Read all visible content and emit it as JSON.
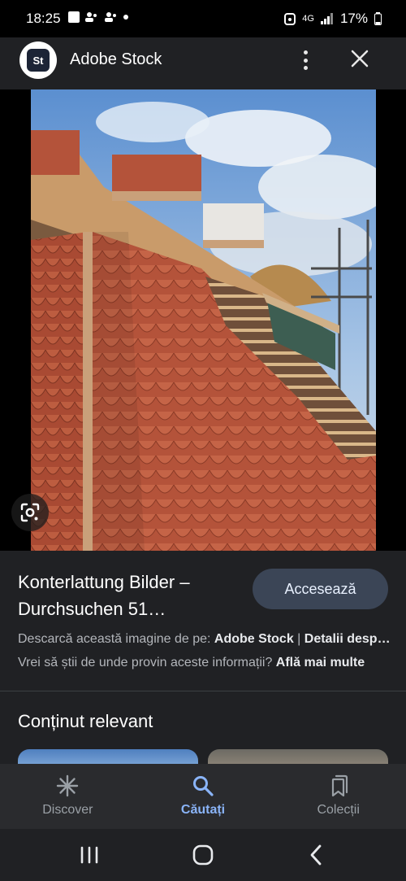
{
  "status_bar": {
    "time": "18:25",
    "network": "4G",
    "battery": "17%"
  },
  "header": {
    "logo_text": "St",
    "title": "Adobe Stock",
    "menu_icon": "more-vert-icon",
    "close_icon": "close-icon"
  },
  "image": {
    "lens_icon": "google-lens-icon"
  },
  "result": {
    "title": "Konterlattung Bilder – Durchsuchen 51…",
    "visit_label": "Accesează",
    "source_prefix": "Descarcă această imagine de pe: ",
    "source_name": "Adobe Stock",
    "source_separator": " | ",
    "source_details": "Detalii desp…",
    "info_question": "Vrei să știi de unde provin aceste informații? ",
    "info_link": "Află mai multe"
  },
  "related": {
    "section_title": "Conținut relevant"
  },
  "bottom_nav": {
    "items": [
      {
        "label": "Discover",
        "icon": "asterisk-icon",
        "active": false
      },
      {
        "label": "Căutați",
        "icon": "search-icon",
        "active": true
      },
      {
        "label": "Colecții",
        "icon": "bookmarks-icon",
        "active": false
      }
    ]
  },
  "colors": {
    "accent": "#8ab4f8",
    "button_bg": "#3b4556",
    "surface": "#202124"
  }
}
